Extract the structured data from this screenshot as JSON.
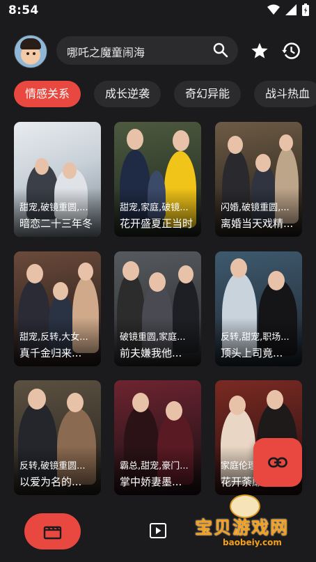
{
  "status_bar": {
    "time": "8:54"
  },
  "search": {
    "text": "哪吒之魔童闹海"
  },
  "categories": [
    {
      "label": "情感关系",
      "active": true
    },
    {
      "label": "成长逆袭",
      "active": false
    },
    {
      "label": "奇幻异能",
      "active": false
    },
    {
      "label": "战斗热血",
      "active": false
    }
  ],
  "dramas": [
    {
      "tags": "甜宠,破镜重圆,...",
      "title": "暗恋二十三年冬"
    },
    {
      "tags": "甜宠,家庭,破镜...",
      "title": "花开盛夏正当时"
    },
    {
      "tags": "闪婚,破镜重圆,...",
      "title": "离婚当天戏精..."
    },
    {
      "tags": "甜宠,反转,大女...",
      "title": "真千金归来..."
    },
    {
      "tags": "破镜重圆,家庭...",
      "title": "前夫嫌我他..."
    },
    {
      "tags": "反转,甜宠,职场...",
      "title": "顶头上司竟..."
    },
    {
      "tags": "反转,破镜重圆...",
      "title": "以爱为名的..."
    },
    {
      "tags": "霸总,甜宠,豪门...",
      "title": "掌中娇妻墨..."
    },
    {
      "tags": "家庭伦理...",
      "title": "花开荼蘼"
    }
  ],
  "watermark": {
    "text": "宝贝游戏网",
    "url": "baobeiy.com"
  },
  "colors": {
    "accent": "#e8483f",
    "background": "#1b1b1d",
    "surface": "#2b2b2d"
  }
}
